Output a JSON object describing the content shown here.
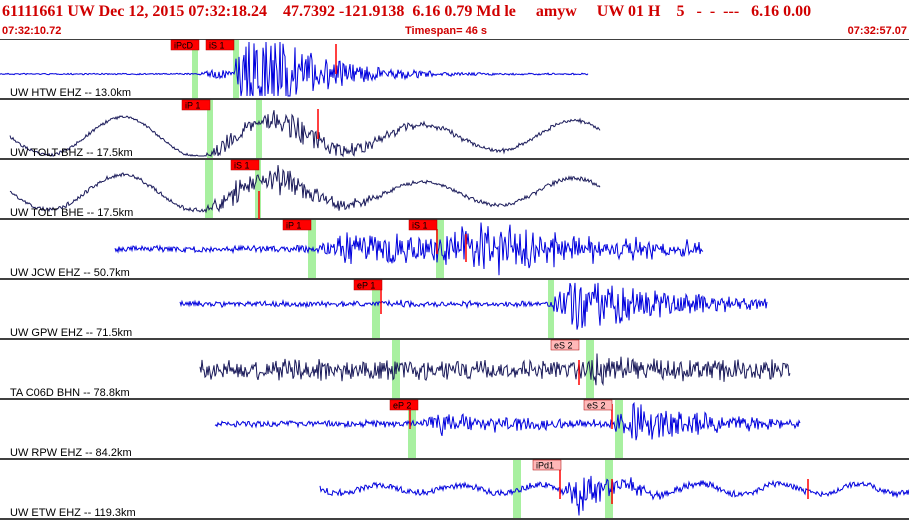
{
  "header": {
    "title": "61111661 UW Dec 12, 2015 07:32:18.24    47.7392 -121.9138  6.16 0.79 Md le     amyw     UW 01 H    5   -  -  ---   6.16 0.00",
    "start_time": "07:32:10.72",
    "timespan": "Timespan=  46 s",
    "end_time": "07:32:57.07"
  },
  "colors": {
    "header_text": "#d00000",
    "trace_blue": "#0000dd",
    "trace_dark": "#1a1a5a",
    "pick_red": "#ff0000",
    "pick_pink": "#ffb8b8",
    "window_green": "#a8f0a0"
  },
  "traces": [
    {
      "label": "UW HTW EHZ -- 13.0km",
      "picks": [
        "iPcD",
        "iS 1"
      ]
    },
    {
      "label": "UW TOLT BHZ -- 17.5km",
      "picks": [
        "iP 1"
      ]
    },
    {
      "label": "UW TOLT BHE -- 17.5km",
      "picks": [
        "iS 1"
      ]
    },
    {
      "label": "UW JCW EHZ -- 50.7km",
      "picks": [
        "iP 1",
        "iS 1"
      ]
    },
    {
      "label": "UW GPW EHZ -- 71.5km",
      "picks": [
        "eP 1"
      ]
    },
    {
      "label": "TA C06D BHN -- 78.8km",
      "picks": [
        "eS 2"
      ]
    },
    {
      "label": "UW RPW EHZ -- 84.2km",
      "picks": [
        "eP 2",
        "eS 2"
      ]
    },
    {
      "label": "UW ETW EHZ -- 119.3km",
      "picks": [
        "iPd1"
      ]
    }
  ]
}
